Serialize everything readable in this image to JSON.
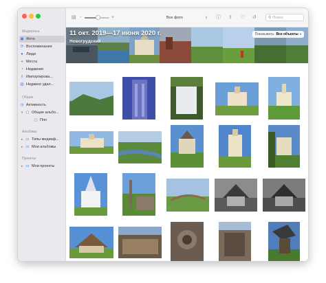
{
  "window": {
    "controls": [
      "close",
      "minimize",
      "zoom"
    ]
  },
  "sidebar": {
    "sections": [
      {
        "label": "Медиатека"
      },
      {
        "label": "Общие"
      },
      {
        "label": "Альбомы"
      },
      {
        "label": "Проекты"
      }
    ],
    "library_items": [
      {
        "label": "Фото",
        "icon": "photos-icon",
        "selected": true
      },
      {
        "label": "Воспоминания",
        "icon": "memories-icon"
      },
      {
        "label": "Люди",
        "icon": "people-icon"
      },
      {
        "label": "Места",
        "icon": "places-icon"
      },
      {
        "label": "Недавние",
        "icon": "recents-icon"
      },
      {
        "label": "Импортирова...",
        "icon": "imports-icon"
      },
      {
        "label": "Недавно удал...",
        "icon": "trash-icon"
      }
    ],
    "shared_items": [
      {
        "label": "Активность",
        "icon": "activity-icon"
      },
      {
        "label": "Общие альбо...",
        "icon": "shared-albums-icon"
      },
      {
        "label": "Ппп",
        "icon": "album-icon"
      }
    ],
    "album_items": [
      {
        "label": "Типы медиаф...",
        "icon": "folder-icon"
      },
      {
        "label": "Мои альбомы",
        "icon": "folder-icon"
      }
    ],
    "project_items": [
      {
        "label": "Мои проекты",
        "icon": "folder-icon"
      }
    ]
  },
  "toolbar": {
    "zoom_level": 0.55,
    "view_selector": "Все фото",
    "icons": [
      "sidebar-toggle-icon",
      "zoom-out-icon",
      "zoom-in-icon",
      "info-icon",
      "share-icon",
      "favorite-icon",
      "rotate-icon",
      "search-icon"
    ],
    "search_placeholder": "Поиск"
  },
  "header": {
    "date_range": "11 окт. 2019—17 июня 2020 г.",
    "location": "Новогрудский",
    "filter_prefix": "Показывать:",
    "filter_value": "Все объекты"
  },
  "colors": {
    "accent": "#2d7be8",
    "sidebar_bg": "#ebe9ee",
    "toolbar_bg": "#f6f6f6"
  }
}
